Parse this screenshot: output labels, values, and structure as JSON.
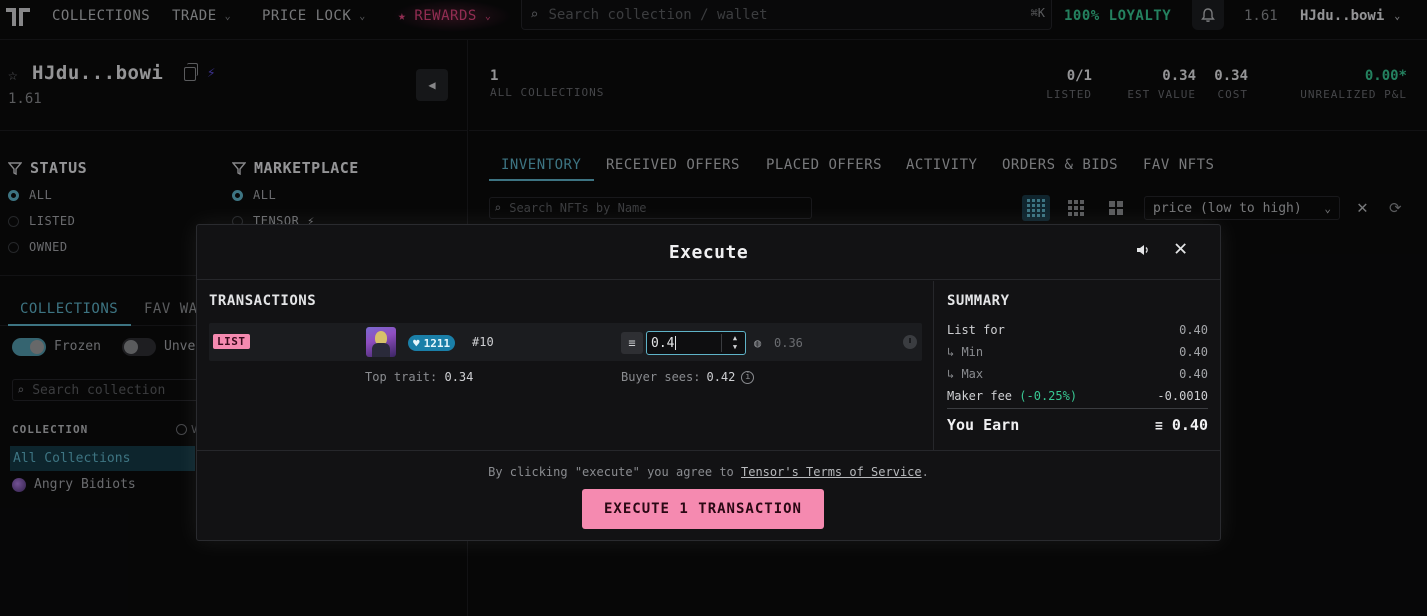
{
  "nav": {
    "items": [
      {
        "label": "COLLECTIONS",
        "has_chevron": false
      },
      {
        "label": "TRADE",
        "has_chevron": true
      },
      {
        "label": "PRICE LOCK",
        "has_chevron": true
      },
      {
        "label": "REWARDS",
        "has_chevron": true
      }
    ],
    "search_placeholder": "Search collection / wallet",
    "search_shortcut": "⌘K",
    "loyalty": "100% LOYALTY",
    "balance": "1.61",
    "wallet": "HJdu..bowi",
    "accent": "#e0457f"
  },
  "profile": {
    "name": "HJdu...bowi",
    "balance": "1.61"
  },
  "filters": {
    "status": {
      "title": "STATUS",
      "options": [
        "ALL",
        "LISTED",
        "OWNED"
      ],
      "selected": "ALL"
    },
    "marketplace": {
      "title": "MARKETPLACE",
      "options": [
        "ALL",
        "TENSOR ⚡"
      ],
      "selected": "ALL"
    }
  },
  "left_tabs": {
    "collections": "COLLECTIONS",
    "fav_wallets": "FAV WA"
  },
  "toggles": {
    "frozen": {
      "label": "Frozen",
      "on": true
    },
    "unverified": {
      "label": "Unve",
      "on": false
    }
  },
  "collections": {
    "search_placeholder": "Search collection",
    "header": "COLLECTION",
    "header_extra": "V",
    "all_label": "All Collections",
    "items": [
      "Angry Bidiots"
    ]
  },
  "stats": {
    "all_collections": {
      "value": "1",
      "label": "ALL COLLECTIONS"
    },
    "listed": {
      "value": "0/1",
      "label": "LISTED"
    },
    "est_value": {
      "value": "0.34",
      "label": "EST VALUE"
    },
    "cost": {
      "value": "0.34",
      "label": "COST"
    },
    "pnl": {
      "value": "0.00*",
      "label": "UNREALIZED P&L"
    }
  },
  "tabs": [
    "INVENTORY",
    "RECEIVED OFFERS",
    "PLACED OFFERS",
    "ACTIVITY",
    "ORDERS & BIDS",
    "FAV NFTS"
  ],
  "active_tab": "INVENTORY",
  "nft_search_placeholder": "Search NFTs by Name",
  "sort": "price (low to high)",
  "modal": {
    "title": "Execute",
    "transactions_title": "TRANSACTIONS",
    "tx": {
      "action": "LIST",
      "rank": "1211",
      "number": "#10",
      "price_value": "0.4",
      "floor": "0.36",
      "top_trait_label": "Top trait:",
      "top_trait_value": "0.34",
      "buyer_sees_label": "Buyer sees:",
      "buyer_sees_value": "0.42"
    },
    "summary": {
      "title": "SUMMARY",
      "list_for": {
        "label": "List for",
        "value": "0.40"
      },
      "min": {
        "label": "↳ Min",
        "value": "0.40"
      },
      "max": {
        "label": "↳ Max",
        "value": "0.40"
      },
      "maker_fee": {
        "label": "Maker fee",
        "pct": "(-0.25%)",
        "value": "-0.0010"
      },
      "you_earn": {
        "label": "You Earn",
        "value": "0.40"
      }
    },
    "tos_prefix": "By clicking \"execute\" you agree to",
    "tos_link": "Tensor's Terms of Service",
    "tos_suffix": ".",
    "execute_label": "EXECUTE 1 TRANSACTION",
    "button_color": "#f58ab0"
  }
}
